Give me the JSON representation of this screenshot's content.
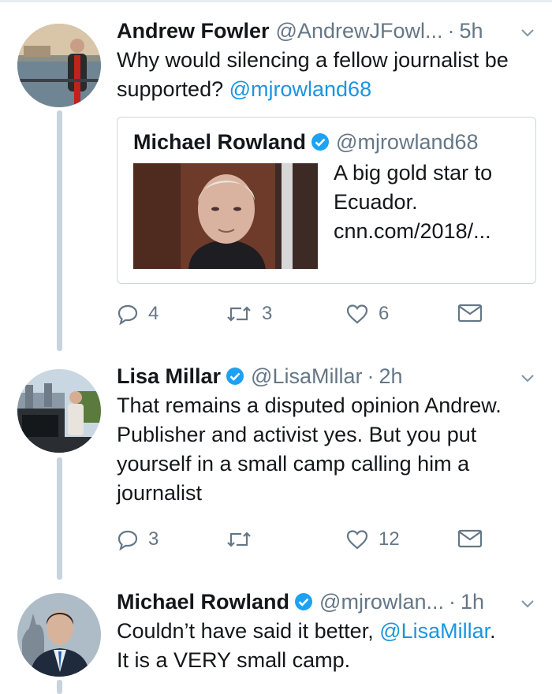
{
  "tweets": [
    {
      "name": "Andrew Fowler",
      "handle": "@AndrewJFowl...",
      "dot": "·",
      "time": "5h",
      "text_parts": [
        "Why would silencing a fellow journalist be supported? ",
        "@mjrowland68"
      ],
      "quote": {
        "name": "Michael Rowland",
        "handle": "@mjrowland68",
        "text_line1": "A big gold star to",
        "text_line2": "Ecuador.",
        "text_line3": "cnn.com/2018/..."
      },
      "actions": {
        "replies": "4",
        "retweets": "3",
        "likes": "6"
      }
    },
    {
      "name": "Lisa Millar",
      "handle": "@LisaMillar",
      "dot": "·",
      "time": "2h",
      "text_parts": [
        "That remains a disputed opinion Andrew. Publisher and activist yes. But you put yourself in a small camp calling him a journalist"
      ],
      "actions": {
        "replies": "3",
        "retweets": "",
        "likes": "12"
      }
    },
    {
      "name": "Michael Rowland",
      "handle": "@mjrowlan...",
      "dot": "·",
      "time": "1h",
      "text_parts": [
        "Couldn’t have said it better, ",
        "@LisaMillar",
        ".",
        "It is a VERY small camp."
      ]
    }
  ],
  "colors": {
    "link": "#1b95e0",
    "verified": "#1da1f2",
    "muted": "#657786",
    "thread_line": "#c8d3dc"
  },
  "icons": [
    "reply-icon",
    "retweet-icon",
    "like-icon",
    "direct-message-icon",
    "verified-badge-icon",
    "chevron-down-icon"
  ]
}
